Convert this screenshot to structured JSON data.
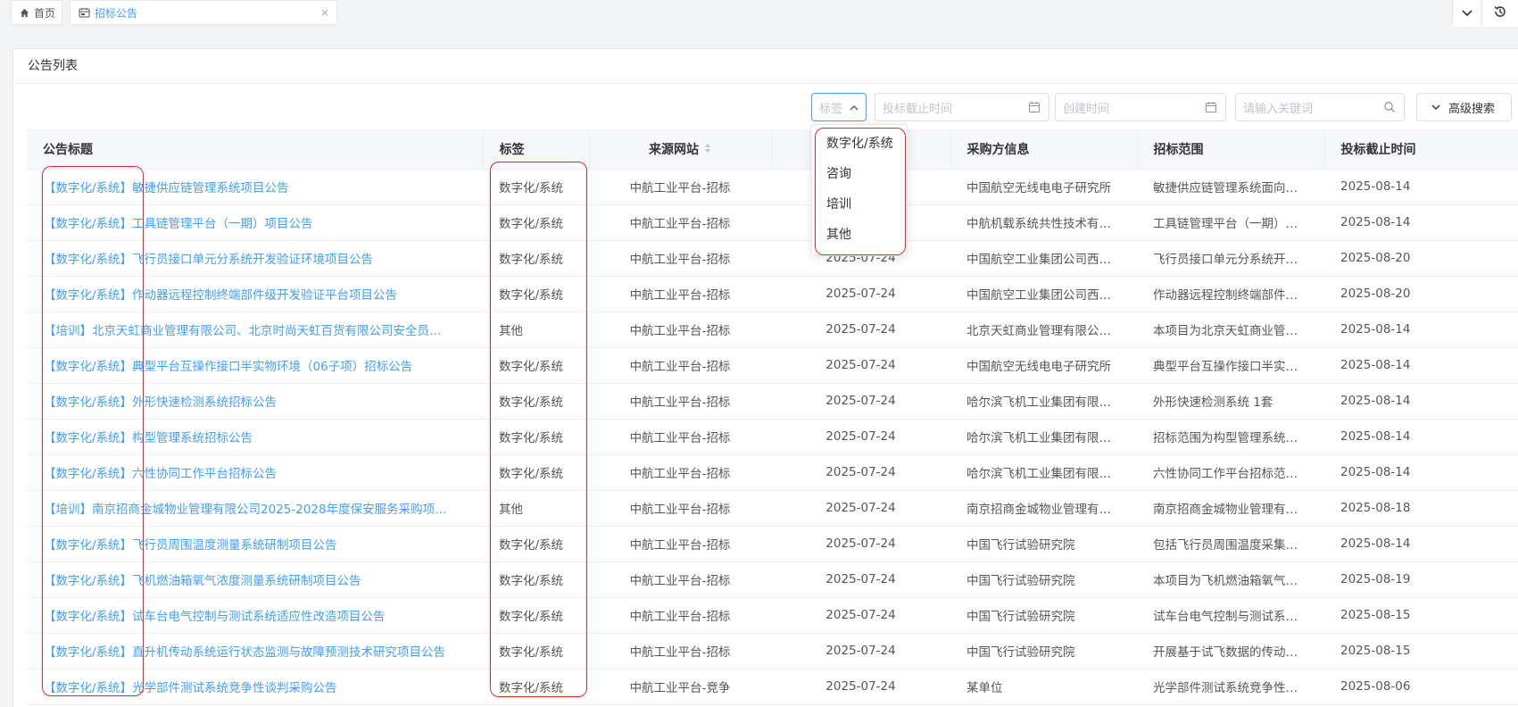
{
  "tabs": {
    "home_label": "首页",
    "notice_label": "招标公告",
    "close_glyph": "×"
  },
  "card": {
    "title": "公告列表"
  },
  "filters": {
    "tag_placeholder": "标签",
    "deadline_placeholder": "投标截止时间",
    "created_placeholder": "创建时间",
    "search_placeholder": "请输入关键词",
    "advanced_label": "高级搜索"
  },
  "tag_dropdown": {
    "options": [
      "数字化/系统",
      "咨询",
      "培训",
      "其他"
    ]
  },
  "table": {
    "headers": [
      "公告标题",
      "标签",
      "来源网站",
      "",
      "采购方信息",
      "招标范围",
      "投标截止时间"
    ],
    "rows": [
      [
        "【数字化/系统】敏捷供应链管理系统项目公告",
        "数字化/系统",
        "中航工业平台-招标",
        "",
        "中国航空无线电电子研究所",
        "敏捷供应链管理系统面向…",
        "2025-08-14"
      ],
      [
        "【数字化/系统】工具链管理平台（一期）项目公告",
        "数字化/系统",
        "中航工业平台-招标",
        "",
        "中航机载系统共性技术有…",
        "工具链管理平台（一期）…",
        "2025-08-14"
      ],
      [
        "【数字化/系统】飞行员接口单元分系统开发验证环境项目公告",
        "数字化/系统",
        "中航工业平台-招标",
        "2025-07-24",
        "中国航空工业集团公司西…",
        "飞行员接口单元分系统开…",
        "2025-08-20"
      ],
      [
        "【数字化/系统】作动器远程控制终端部件级开发验证平台项目公告",
        "数字化/系统",
        "中航工业平台-招标",
        "2025-07-24",
        "中国航空工业集团公司西…",
        "作动器远程控制终端部件…",
        "2025-08-20"
      ],
      [
        "【培训】北京天虹商业管理有限公司、北京时尚天虹百货有限公司安全员…",
        "其他",
        "中航工业平台-招标",
        "2025-07-24",
        "北京天虹商业管理有限公…",
        "本项目为北京天虹商业管…",
        "2025-08-14"
      ],
      [
        "【数字化/系统】典型平台互操作接口半实物环境（06子项）招标公告",
        "数字化/系统",
        "中航工业平台-招标",
        "2025-07-24",
        "中国航空无线电电子研究所",
        "典型平台互操作接口半实…",
        "2025-08-14"
      ],
      [
        "【数字化/系统】外形快速检测系统招标公告",
        "数字化/系统",
        "中航工业平台-招标",
        "2025-07-24",
        "哈尔滨飞机工业集团有限…",
        "外形快速检测系统 1套",
        "2025-08-14"
      ],
      [
        "【数字化/系统】构型管理系统招标公告",
        "数字化/系统",
        "中航工业平台-招标",
        "2025-07-24",
        "哈尔滨飞机工业集团有限…",
        "招标范围为构型管理系统…",
        "2025-08-14"
      ],
      [
        "【数字化/系统】六性协同工作平台招标公告",
        "数字化/系统",
        "中航工业平台-招标",
        "2025-07-24",
        "哈尔滨飞机工业集团有限…",
        "六性协同工作平台招标范…",
        "2025-08-14"
      ],
      [
        "【培训】南京招商金城物业管理有限公司2025-2028年度保安服务采购项…",
        "其他",
        "中航工业平台-招标",
        "2025-07-24",
        "南京招商金城物业管理有…",
        "南京招商金城物业管理有…",
        "2025-08-18"
      ],
      [
        "【数字化/系统】飞行员周围温度测量系统研制项目公告",
        "数字化/系统",
        "中航工业平台-招标",
        "2025-07-24",
        "中国飞行试验研究院",
        "包括飞行员周围温度采集…",
        "2025-08-14"
      ],
      [
        "【数字化/系统】飞机燃油箱氧气浓度测量系统研制项目公告",
        "数字化/系统",
        "中航工业平台-招标",
        "2025-07-24",
        "中国飞行试验研究院",
        "本项目为飞机燃油箱氧气…",
        "2025-08-19"
      ],
      [
        "【数字化/系统】试车台电气控制与测试系统适应性改造项目公告",
        "数字化/系统",
        "中航工业平台-招标",
        "2025-07-24",
        "中国飞行试验研究院",
        "试车台电气控制与测试系…",
        "2025-08-15"
      ],
      [
        "【数字化/系统】直升机传动系统运行状态监测与故障预测技术研究项目公告",
        "数字化/系统",
        "中航工业平台-招标",
        "2025-07-24",
        "中国飞行试验研究院",
        "开展基于试飞数据的传动…",
        "2025-08-15"
      ],
      [
        "【数字化/系统】光学部件测试系统竞争性谈判采购公告",
        "数字化/系统",
        "中航工业平台-竞争",
        "2025-07-24",
        "某单位",
        "光学部件测试系统竞争性…",
        "2025-08-06"
      ]
    ]
  },
  "colors": {
    "accent": "#409eff",
    "annotation": "#e02b2b",
    "header_bg": "#f5f7fa"
  }
}
